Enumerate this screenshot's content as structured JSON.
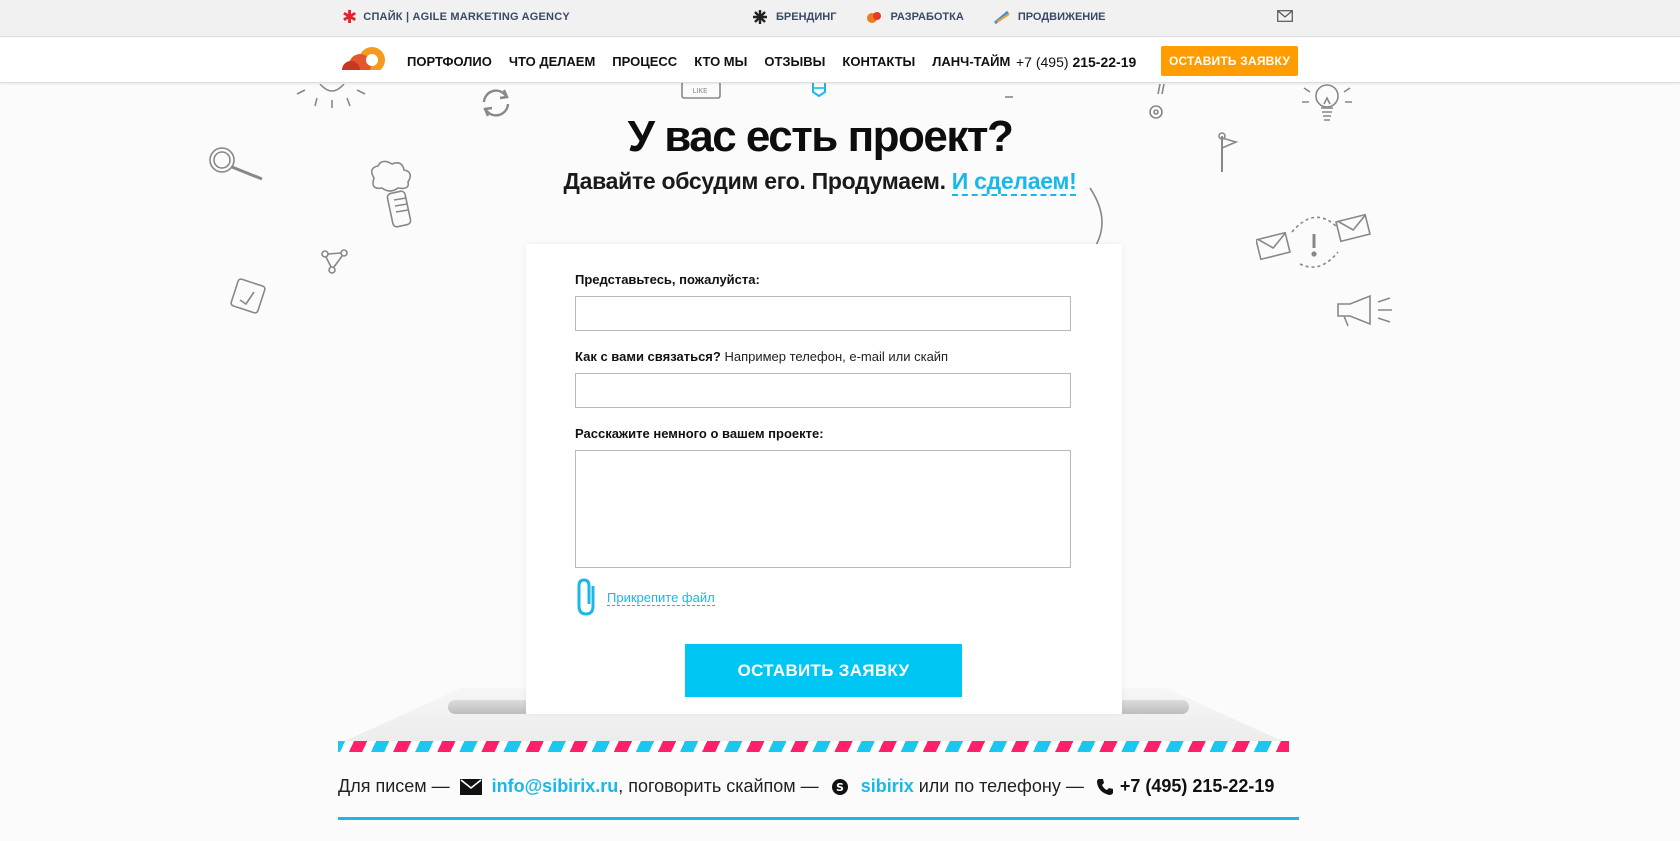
{
  "topbar": {
    "agency": "СПАЙК | AGILE MARKETING AGENCY",
    "links": [
      {
        "label": "БРЕНДИНГ",
        "icon": "branding-icon"
      },
      {
        "label": "РАЗРАБОТКА",
        "icon": "development-icon"
      },
      {
        "label": "ПРОДВИЖЕНИЕ",
        "icon": "promotion-icon"
      }
    ],
    "mail_icon": "mail-icon"
  },
  "nav": {
    "items": [
      "ПОРТФОЛИО",
      "ЧТО ДЕЛАЕМ",
      "ПРОЦЕСС",
      "КТО МЫ",
      "ОТЗЫВЫ",
      "КОНТАКТЫ",
      "ЛАНЧ-ТАЙМ"
    ],
    "phone_prefix": "+7 (495) ",
    "phone_number": "215-22-19",
    "cta": "ОСТАВИТЬ ЗАЯВКУ"
  },
  "hero": {
    "title": "У вас есть проект?",
    "subtitle": "Давайте обсудим его. Продумаем.",
    "subtitle_accent": "И сделаем!"
  },
  "form": {
    "name_label": "Представьтесь, пожалуйста:",
    "name_value": "",
    "contact_label": "Как с вами связаться?",
    "contact_hint": "Например телефон, e-mail или скайп",
    "contact_value": "",
    "project_label": "Расскажите немного о вашем проекте:",
    "project_value": "",
    "attach_label": "Прикрепите файл",
    "submit": "ОСТАВИТЬ ЗАЯВКУ"
  },
  "contacts": {
    "mail_prefix": "Для писем —",
    "email": "info@sibirix.ru",
    "skype_prefix": ", поговорить скайпом —",
    "skype": "sibirix",
    "phone_prefix": "или по телефону —",
    "phone": "+7 (495) 215-22-19"
  },
  "colors": {
    "accent_blue": "#1ab8ea",
    "orange_button": "#ff9c00",
    "submit_blue": "#00c6f3",
    "stripe_pink": "#ff1f6b"
  }
}
